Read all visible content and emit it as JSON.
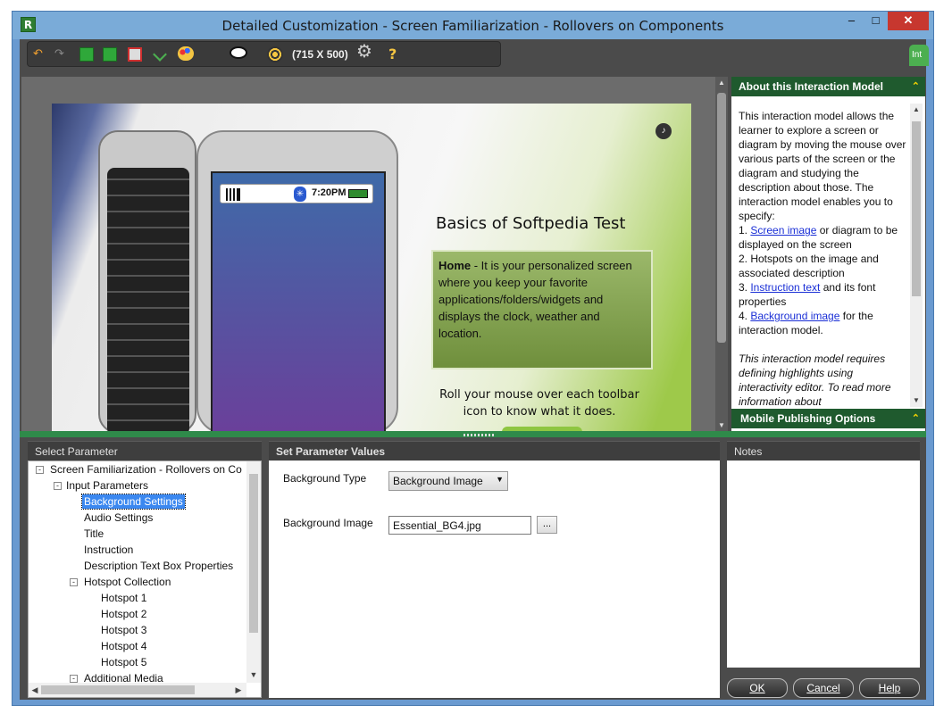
{
  "window": {
    "app_icon": "R",
    "title": "Detailed Customization - Screen Familiarization - Rollovers on Components",
    "min_glyph": "–",
    "max_glyph": "□",
    "close_glyph": "✕"
  },
  "toolbar": {
    "icons": [
      "undo-icon",
      "redo-icon",
      "save-icon",
      "save-all-icon",
      "delete-icon",
      "spellcheck-icon",
      "theme-icon",
      "preview-icon",
      "target-icon",
      "settings-icon",
      "help-icon"
    ],
    "undo_glyph": "↶",
    "redo_glyph": "↷",
    "preview_glyph": "👁",
    "settings_glyph": "⚙",
    "help_glyph": "?",
    "resolution": "(715 X 500)",
    "side_tab": "Int"
  },
  "stage": {
    "status_time": "7:20PM",
    "bluetooth_glyph": "✳",
    "speaker_glyph": "♪",
    "heading": "Basics of Softpedia Test",
    "desc_bold": "Home",
    "desc_text": " - It is your personalized screen where you keep your favorite applications/folders/widgets and displays the clock, weather and location.",
    "roll_text": "Roll your mouse over each toolbar icon to know what it does."
  },
  "about": {
    "title": "About this Interaction Model",
    "chevron": "⌃",
    "intro": "This interaction model allows the learner to explore a screen or diagram by moving the mouse over various parts of the screen or the diagram and studying the description about those. The interaction model enables you to specify:",
    "item1_num": "1. ",
    "item1_link": "Screen image",
    "item1_rest": " or diagram to be displayed on the screen",
    "item2": "2. Hotspots on the image and associated description",
    "item3_num": "3. ",
    "item3_link": "Instruction text",
    "item3_rest": " and its font properties",
    "item4_num": "4. ",
    "item4_link": "Background image",
    "item4_rest": " for the interaction model.",
    "note": "This interaction model requires defining highlights using interactivity editor. To read more information about",
    "mobile_title": "Mobile Publishing Options"
  },
  "panels": {
    "select_param": "Select Parameter",
    "set_values": "Set Parameter Values",
    "notes": "Notes"
  },
  "tree": {
    "root": "Screen Familiarization - Rollovers on Co",
    "input_params": "Input Parameters",
    "items": [
      "Background Settings",
      "Audio Settings",
      "Title",
      "Instruction",
      "Description Text Box Properties"
    ],
    "hotspot_collection": "Hotspot Collection",
    "hotspots": [
      "Hotspot  1",
      "Hotspot  2",
      "Hotspot  3",
      "Hotspot  4",
      "Hotspot  5"
    ],
    "additional_media": "Additional Media",
    "selected": "Background Settings"
  },
  "params": {
    "bg_type_label": "Background Type",
    "bg_type_value": "Background Image",
    "bg_image_label": "Background Image",
    "bg_image_value": "Essential_BG4.jpg",
    "browse_label": "..."
  },
  "buttons": {
    "ok": "OK",
    "cancel": "Cancel",
    "help": "Help"
  },
  "colors": {
    "accent_green": "#1f5a2e",
    "divider_green": "#2f8a4a",
    "selection_blue": "#3b88f0",
    "link_blue": "#1a2fd6"
  }
}
